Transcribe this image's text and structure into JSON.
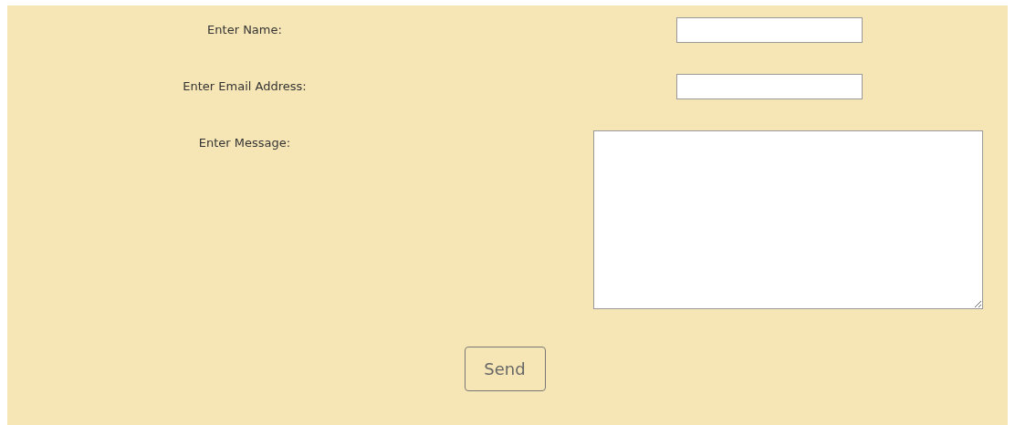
{
  "fields": [
    {
      "kind": "input",
      "label": "Enter Name:"
    },
    {
      "kind": "input",
      "label": "Enter Email Address:"
    },
    {
      "kind": "textarea",
      "label": "Enter Message:"
    }
  ],
  "submit": {
    "label": "Send"
  }
}
